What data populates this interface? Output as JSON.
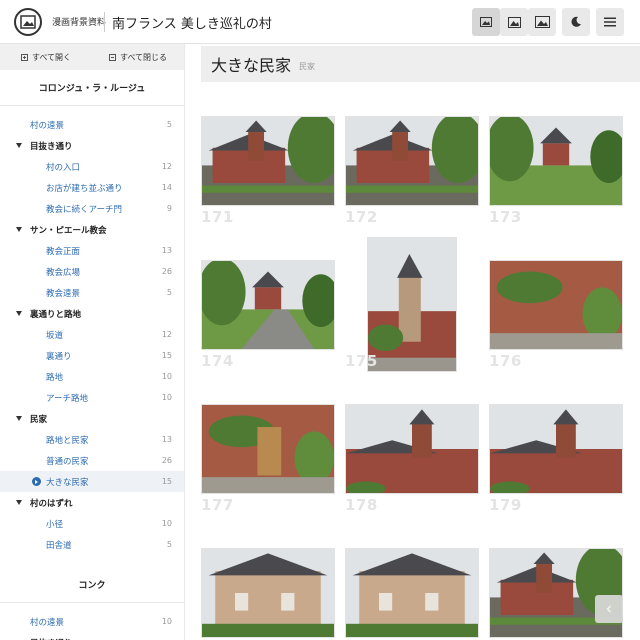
{
  "header": {
    "site_name": "漫画背景資料",
    "title": "南フランス 美しき巡礼の村",
    "buttons": [
      {
        "name": "view-small-button",
        "icon": "image-small-icon"
      },
      {
        "name": "view-medium-button",
        "icon": "image-medium-icon"
      },
      {
        "name": "view-large-button",
        "icon": "image-large-icon"
      },
      {
        "name": "dark-mode-button",
        "icon": "moon-icon"
      },
      {
        "name": "menu-button",
        "icon": "hamburger-icon"
      }
    ]
  },
  "sidebar": {
    "expand_all": "すべて開く",
    "collapse_all": "すべて閉じる",
    "section1": {
      "title": "コロンジュ・ラ・ルージュ",
      "items": [
        {
          "label": "村の遠景",
          "count": "5",
          "level": 1
        },
        {
          "label": "目抜き通り",
          "count": "",
          "level": 0
        },
        {
          "label": "村の入口",
          "count": "12",
          "level": 2
        },
        {
          "label": "お店が建ち並ぶ通り",
          "count": "14",
          "level": 2
        },
        {
          "label": "教会に続くアーチ門",
          "count": "9",
          "level": 2
        },
        {
          "label": "サン・ピエール教会",
          "count": "",
          "level": 0
        },
        {
          "label": "教会正面",
          "count": "13",
          "level": 2
        },
        {
          "label": "教会広場",
          "count": "26",
          "level": 2
        },
        {
          "label": "教会遠景",
          "count": "5",
          "level": 2
        },
        {
          "label": "裏通りと路地",
          "count": "",
          "level": 0
        },
        {
          "label": "坂道",
          "count": "12",
          "level": 2
        },
        {
          "label": "裏通り",
          "count": "15",
          "level": 2
        },
        {
          "label": "路地",
          "count": "10",
          "level": 2
        },
        {
          "label": "アーチ路地",
          "count": "10",
          "level": 2
        },
        {
          "label": "民家",
          "count": "",
          "level": 0
        },
        {
          "label": "路地と民家",
          "count": "13",
          "level": 2
        },
        {
          "label": "普通の民家",
          "count": "26",
          "level": 2
        },
        {
          "label": "大きな民家",
          "count": "15",
          "level": 2,
          "active": true
        },
        {
          "label": "村のはずれ",
          "count": "",
          "level": 0
        },
        {
          "label": "小径",
          "count": "10",
          "level": 2
        },
        {
          "label": "田舎道",
          "count": "5",
          "level": 2
        }
      ]
    },
    "section2": {
      "title": "コンク",
      "items": [
        {
          "label": "村の遠景",
          "count": "10",
          "level": 1
        },
        {
          "label": "目抜き通り",
          "count": "",
          "level": 0
        }
      ]
    }
  },
  "main": {
    "heading": "大きな民家",
    "subheading": "民家",
    "photos": [
      {
        "number": "171",
        "scene": "village"
      },
      {
        "number": "172",
        "scene": "village"
      },
      {
        "number": "173",
        "scene": "garden"
      },
      {
        "number": "174",
        "scene": "road"
      },
      {
        "number": "175",
        "scene": "tower"
      },
      {
        "number": "176",
        "scene": "redwall"
      },
      {
        "number": "177",
        "scene": "door"
      },
      {
        "number": "178",
        "scene": "church"
      },
      {
        "number": "179",
        "scene": "church"
      },
      {
        "number": "",
        "scene": "house"
      },
      {
        "number": "",
        "scene": "house"
      },
      {
        "number": "",
        "scene": "village"
      }
    ]
  },
  "colors": {
    "link": "#2d6bb0",
    "stone_red": "#9a4a3c",
    "slate": "#4a4a4e",
    "foliage": "#4f7a33",
    "sky": "#dfe3e6"
  },
  "back_to_top_icon": "chevron-left-icon"
}
